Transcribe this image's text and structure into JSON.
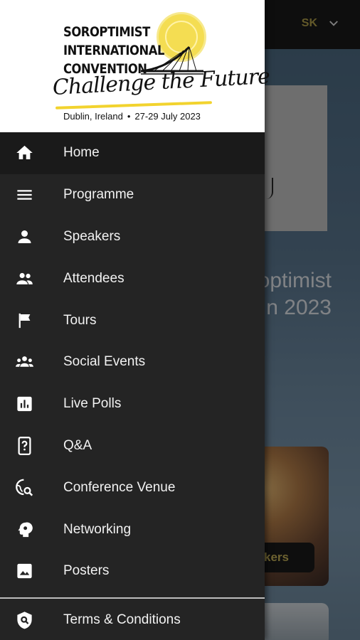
{
  "topbar": {
    "language": "SK",
    "language_icon": "chevron-down-icon"
  },
  "hero": {
    "title": "optimist\nn 2023"
  },
  "card": {
    "button_label": "kers"
  },
  "drawer": {
    "logo": {
      "line1": "SOROPTIMIST",
      "line2": "INTERNATIONAL",
      "line3": "CONVENTION",
      "tagline": "Challenge the Future",
      "location": "Dublin, Ireland",
      "dates": "27-29 July 2023"
    },
    "items": [
      {
        "label": "Home",
        "icon": "home-icon",
        "active": true
      },
      {
        "label": "Programme",
        "icon": "menu-lines-icon"
      },
      {
        "label": "Speakers",
        "icon": "person-icon"
      },
      {
        "label": "Attendees",
        "icon": "people-icon"
      },
      {
        "label": "Tours",
        "icon": "flag-icon"
      },
      {
        "label": "Social Events",
        "icon": "groups-icon"
      },
      {
        "label": "Live Polls",
        "icon": "poll-icon"
      },
      {
        "label": "Q&A",
        "icon": "question-device-icon"
      },
      {
        "label": "Conference Venue",
        "icon": "travel-explore-icon"
      },
      {
        "label": "Networking",
        "icon": "psychology-icon"
      },
      {
        "label": "Posters",
        "icon": "image-icon"
      }
    ],
    "footer_item": {
      "label": "Terms & Conditions",
      "icon": "shield-search-icon"
    }
  },
  "colors": {
    "accent": "#c9b45a",
    "drawer_bg": "#242424",
    "active_bg": "#1a1a1a",
    "logo_yellow": "#f4dd52"
  }
}
